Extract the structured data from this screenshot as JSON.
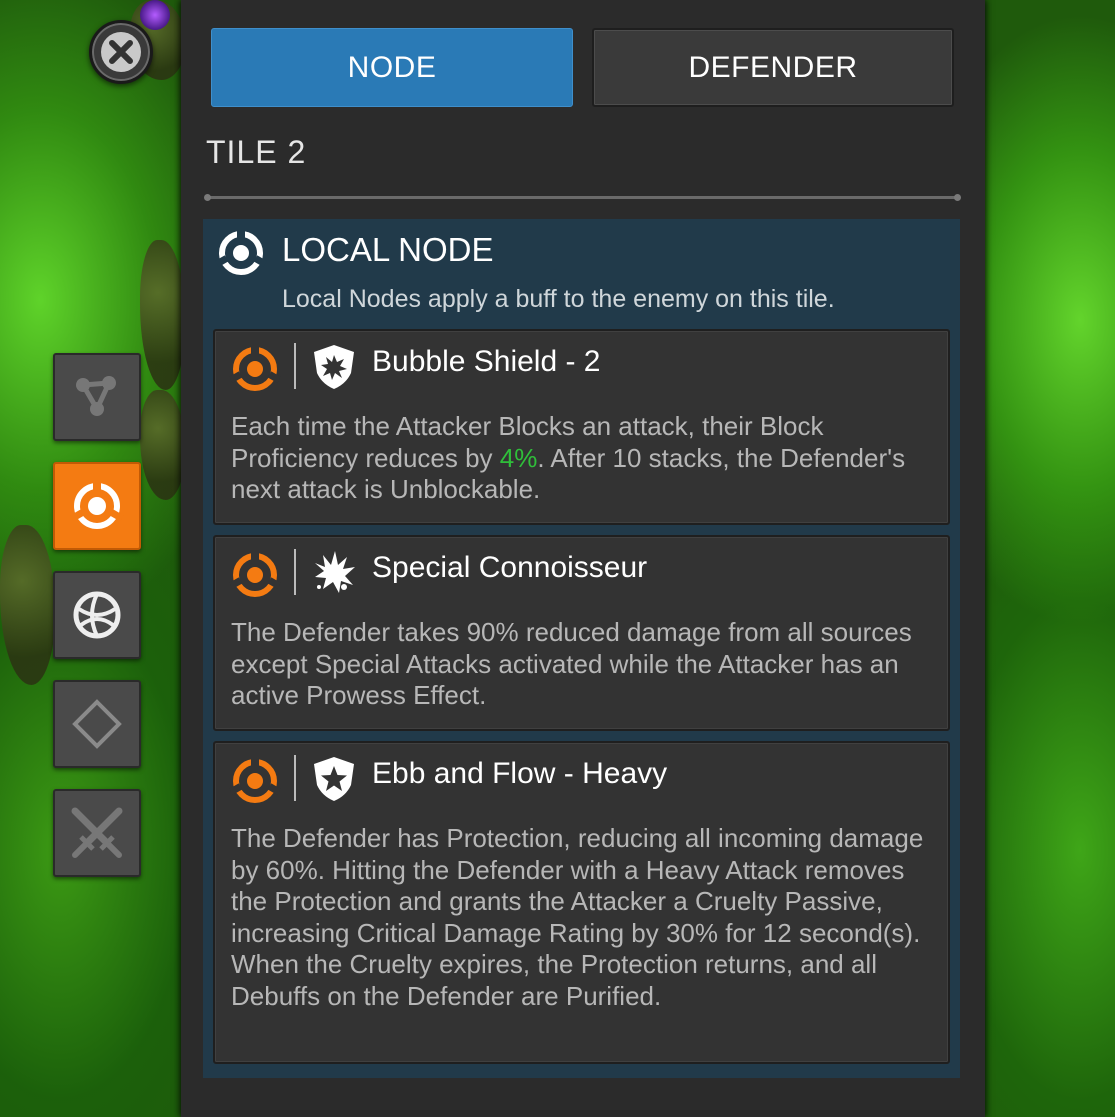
{
  "tabs": {
    "node": "NODE",
    "defender": "DEFENDER"
  },
  "tile_title": "TILE 2",
  "section": {
    "title": "LOCAL NODE",
    "description": "Local Nodes apply a buff to the enemy on this tile."
  },
  "cards": [
    {
      "title": "Bubble Shield - 2",
      "icon": "shield-burst-icon",
      "text_before": "Each time the Attacker Blocks an attack, their Block Proficiency reduces by ",
      "highlight": "4%",
      "text_after": ". After 10 stacks, the Defender's next attack is Unblockable."
    },
    {
      "title": "Special Connoisseur",
      "icon": "special-splash-icon",
      "text": "The Defender takes 90% reduced damage from all sources except Special Attacks activated while the Attacker has an active Prowess Effect."
    },
    {
      "title": "Ebb and Flow - Heavy",
      "icon": "shield-star-icon",
      "text": "The Defender has Protection, reducing all incoming damage by 60%. Hitting the Defender with a Heavy Attack removes the Protection and grants the Attacker a Cruelty Passive, increasing Critical Damage Rating by 30% for 12 second(s). When the Cruelty expires, the Protection returns, and all Debuffs on the Defender are Purified."
    }
  ],
  "side_tabs": [
    {
      "name": "path-tab",
      "icon": "node-graph-icon"
    },
    {
      "name": "local-node-tab",
      "icon": "local-node-icon",
      "active": true
    },
    {
      "name": "global-node-tab",
      "icon": "globe-icon"
    },
    {
      "name": "rewards-tab",
      "icon": "diamond-icon"
    },
    {
      "name": "fight-tab",
      "icon": "crossed-swords-icon"
    }
  ],
  "colors": {
    "accent_blue": "#2a7ab6",
    "accent_orange": "#f47b12",
    "highlight_green": "#2fbf3a",
    "section_bg": "#213a4a"
  }
}
